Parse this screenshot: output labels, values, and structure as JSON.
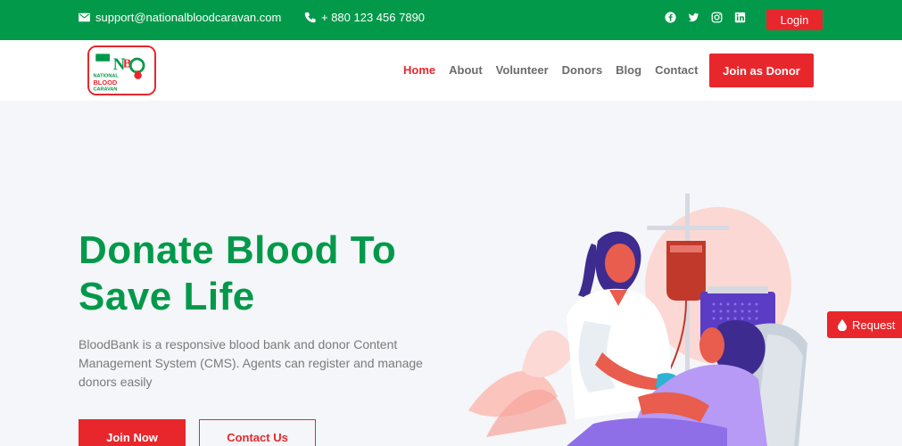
{
  "topbar": {
    "email": "support@nationalbloodcaravan.com",
    "phone": "+ 880 123 456 7890",
    "socials": [
      "facebook-icon",
      "twitter-icon",
      "instagram-icon",
      "linkedin-icon"
    ],
    "login_label": "Login",
    "background": "#03994a"
  },
  "nav": {
    "logo_text": [
      "NATIONAL",
      "BLOOD",
      "CARAVAN"
    ],
    "items": [
      {
        "label": "Home",
        "active": true
      },
      {
        "label": "About",
        "active": false
      },
      {
        "label": "Volunteer",
        "active": false
      },
      {
        "label": "Donors",
        "active": false
      },
      {
        "label": "Blog",
        "active": false
      },
      {
        "label": "Contact",
        "active": false
      }
    ],
    "cta_label": "Join as Donor"
  },
  "hero": {
    "title_line1": "Donate Blood To",
    "title_line2": "Save Life",
    "description": "BloodBank is a responsive blood bank and donor Content Management System (CMS). Agents can register and manage donors easily",
    "primary_label": "Join Now",
    "secondary_label": "Contact Us"
  },
  "request_tab": {
    "label": "Request"
  },
  "colors": {
    "accent": "#e8272d",
    "brand_green": "#03994a",
    "text_muted": "#7a7a7a"
  }
}
